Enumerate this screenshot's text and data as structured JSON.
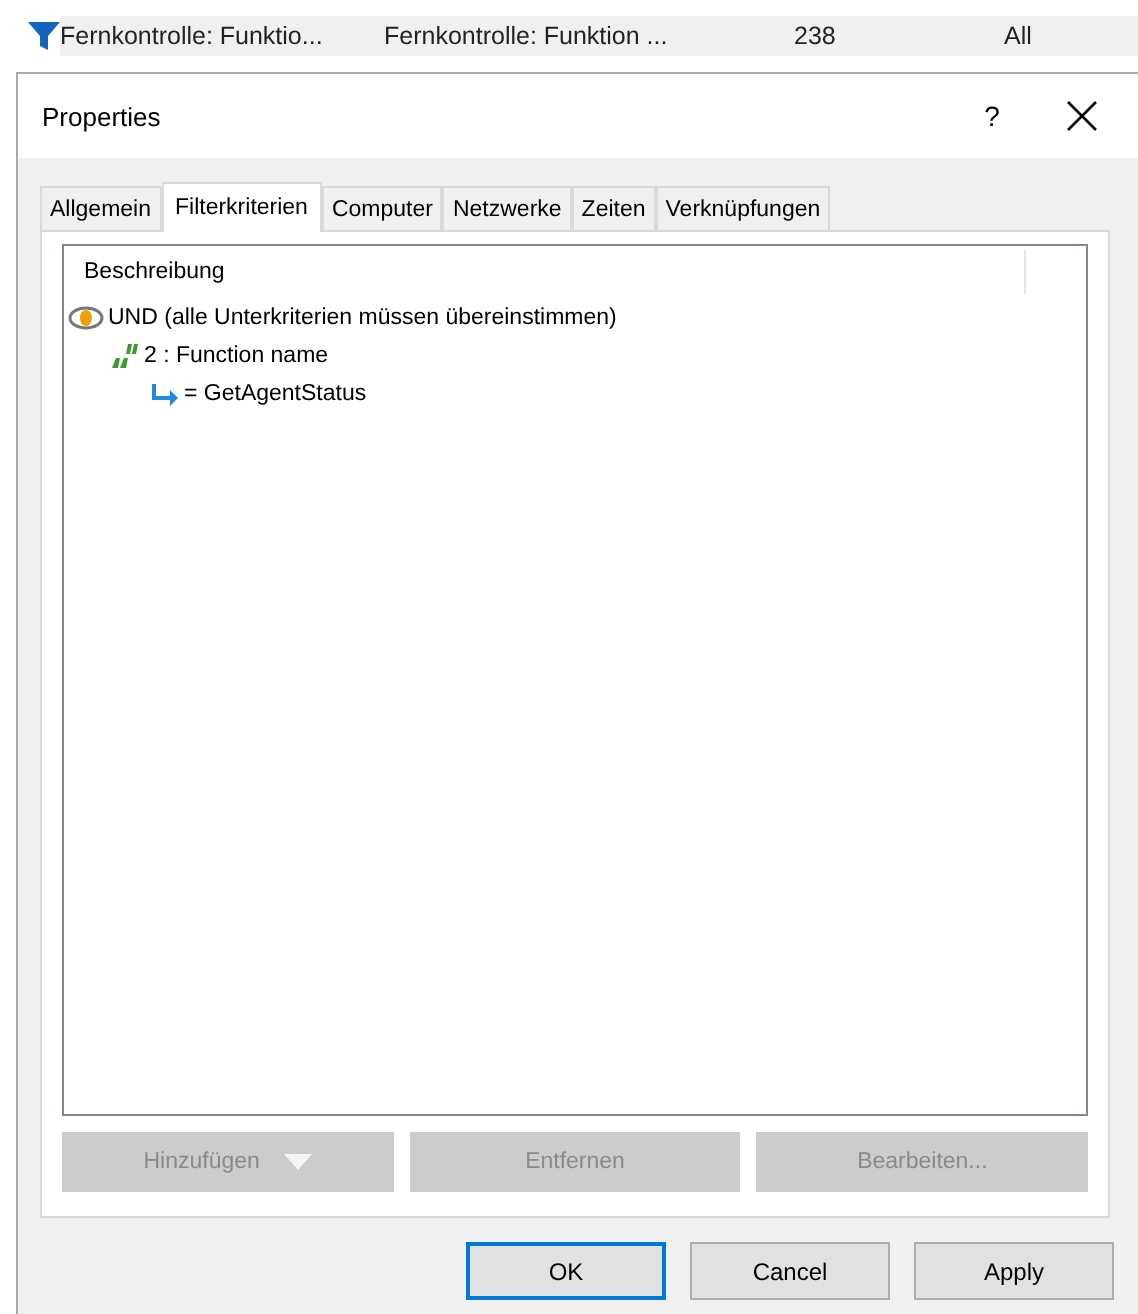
{
  "list_row": {
    "cells": [
      "Fernkontrolle: Funktio...",
      "Fernkontrolle: Funktion ...",
      "238",
      "All"
    ]
  },
  "window": {
    "title": "Properties",
    "help": "?"
  },
  "tabs": [
    {
      "label": "Allgemein",
      "selected": false
    },
    {
      "label": "Filterkriterien",
      "selected": true
    },
    {
      "label": "Computer",
      "selected": false
    },
    {
      "label": "Netzwerke",
      "selected": false
    },
    {
      "label": "Zeiten",
      "selected": false
    },
    {
      "label": "Verknüpfungen",
      "selected": false
    }
  ],
  "tree": {
    "column": "Beschreibung",
    "items": [
      {
        "kind": "and",
        "label": "UND (alle Unterkriterien müssen übereinstimmen)",
        "children": [
          {
            "kind": "criterion",
            "label": "2 : Function name",
            "children": [
              {
                "kind": "value",
                "label": "= GetAgentStatus"
              }
            ]
          }
        ]
      }
    ]
  },
  "tree_buttons": [
    {
      "label": "Hinzufügen",
      "disabled": true,
      "dropdown": true
    },
    {
      "label": "Entfernen",
      "disabled": true,
      "dropdown": false
    },
    {
      "label": "Bearbeiten...",
      "disabled": true,
      "dropdown": false
    }
  ],
  "dialog_buttons": [
    {
      "label": "OK",
      "default": true
    },
    {
      "label": "Cancel",
      "default": false
    },
    {
      "label": "Apply",
      "default": false
    }
  ]
}
